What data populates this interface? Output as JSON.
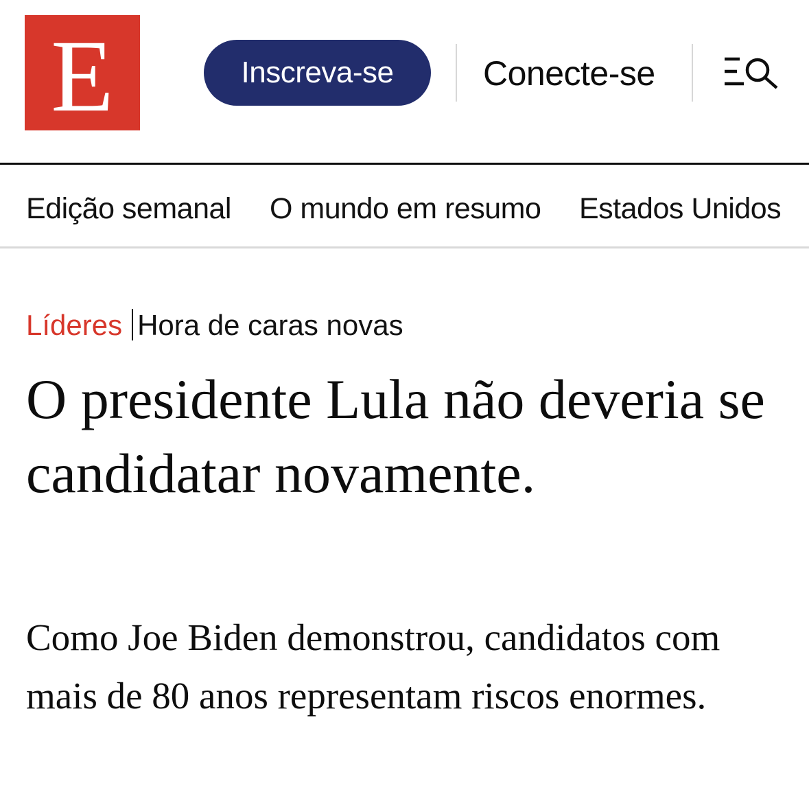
{
  "header": {
    "logo_letter": "E",
    "subscribe_label": "Inscreva-se",
    "login_label": "Conecte-se",
    "menu_icon": "menu-search-icon"
  },
  "sections_nav": {
    "items": [
      {
        "label": "Edição semanal"
      },
      {
        "label": "O mundo em resumo"
      },
      {
        "label": "Estados Unidos"
      }
    ]
  },
  "article": {
    "section": "Líderes",
    "flytitle": "Hora de caras novas",
    "headline": "O presidente Lula não deveria se candidatar novamente.",
    "standfirst": "Como Joe Biden demonstrou, candidatos com mais de 80 anos representam riscos enormes."
  },
  "colors": {
    "brand_red": "#d7372b",
    "subscribe_navy": "#222d6c",
    "text": "#0d0d0d",
    "divider": "#d9d9d9"
  }
}
